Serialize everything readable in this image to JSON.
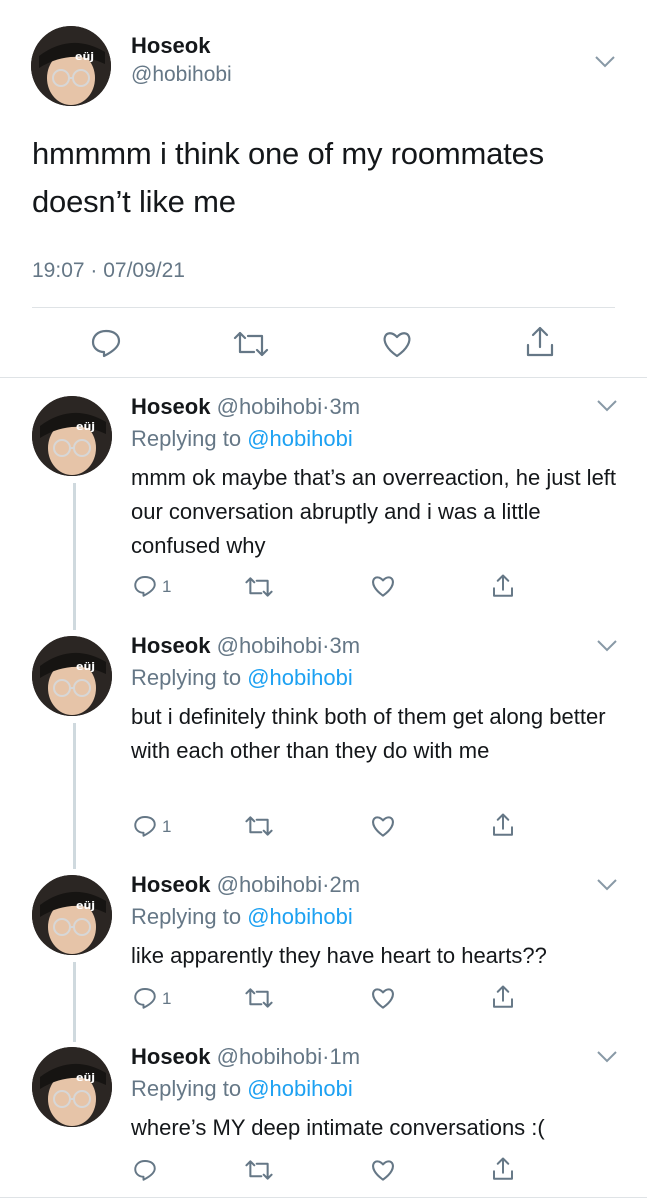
{
  "main_tweet": {
    "name": "Hoseok",
    "handle": "@hobihobi",
    "text": "hmmmm i think one of my roommates doesn’t like me",
    "timestamp": "19:07 · 07/09/21",
    "actions": [
      "reply-icon",
      "retweet-icon",
      "like-icon",
      "share-icon"
    ]
  },
  "replies": [
    {
      "name": "Hoseok",
      "handle": "@hobihobi",
      "sep": "·",
      "time": "3m",
      "replying_prefix": "Replying to",
      "replying_to": "@hobihobi",
      "text": "mmm ok maybe that’s an overreaction, he just left our conversation abruptly and i was a little confused why",
      "reply_count": "1"
    },
    {
      "name": "Hoseok",
      "handle": "@hobihobi",
      "sep": "·",
      "time": "3m",
      "replying_prefix": "Replying to",
      "replying_to": "@hobihobi",
      "text": "but i definitely think both of them get along better with each other than they do with me",
      "reply_count": "1"
    },
    {
      "name": "Hoseok",
      "handle": "@hobihobi",
      "sep": "·",
      "time": "2m",
      "replying_prefix": "Replying to",
      "replying_to": "@hobihobi",
      "text": "like apparently they have heart to hearts??",
      "reply_count": "1"
    },
    {
      "name": "Hoseok",
      "handle": "@hobihobi",
      "sep": "·",
      "time": "1m",
      "replying_prefix": "Replying to",
      "replying_to": "@hobihobi",
      "text": "where’s MY deep intimate conversations :(",
      "reply_count": ""
    }
  ],
  "colors": {
    "text": "#14171a",
    "secondary": "#657786",
    "link": "#1da1f2",
    "divider": "#dfe3e6"
  }
}
